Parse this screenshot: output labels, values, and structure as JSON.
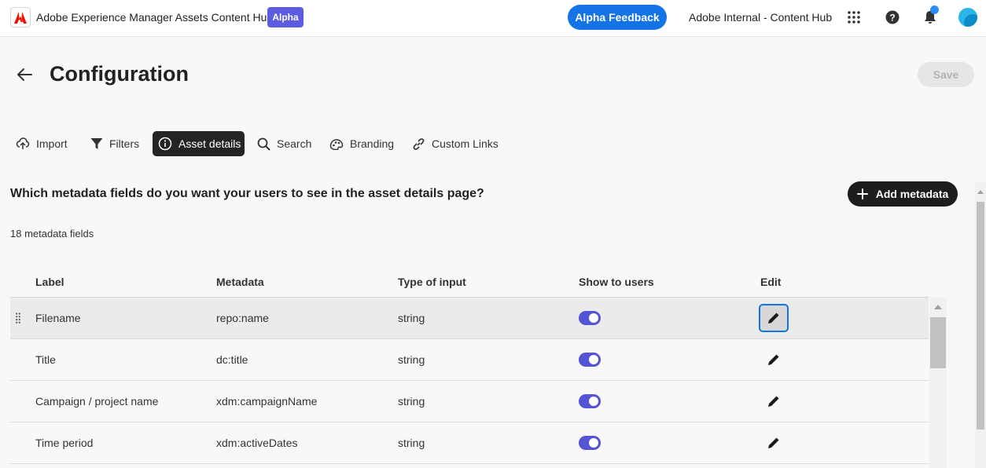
{
  "app": {
    "title": "Adobe Experience Manager Assets Content Hub",
    "badge": "Alpha",
    "feedback_label": "Alpha Feedback",
    "org_name": "Adobe Internal - Content Hub",
    "icons": [
      "adobe-logo-icon",
      "app-switcher-icon",
      "help-icon",
      "bell-icon",
      "avatar"
    ]
  },
  "header": {
    "title": "Configuration",
    "save_label": "Save"
  },
  "tabs": [
    {
      "label": "Import",
      "icon": "upload-icon",
      "active": false
    },
    {
      "label": "Filters",
      "icon": "filter-icon",
      "active": false
    },
    {
      "label": "Asset details",
      "icon": "info-icon",
      "active": true
    },
    {
      "label": "Search",
      "icon": "search-icon",
      "active": false
    },
    {
      "label": "Branding",
      "icon": "branding-icon",
      "active": false
    },
    {
      "label": "Custom Links",
      "icon": "link-icon",
      "active": false
    }
  ],
  "section": {
    "question": "Which metadata fields do you want your users to see in the asset details page?",
    "add_label": "Add metadata",
    "count_text": "18 metadata fields"
  },
  "table": {
    "columns": [
      "Label",
      "Metadata",
      "Type of input",
      "Show to users",
      "Edit"
    ],
    "rows": [
      {
        "label": "Filename",
        "metadata": "repo:name",
        "type": "string",
        "show": true
      },
      {
        "label": "Title",
        "metadata": "dc:title",
        "type": "string",
        "show": true
      },
      {
        "label": "Campaign / project name",
        "metadata": "xdm:campaignName",
        "type": "string",
        "show": true
      },
      {
        "label": "Time period",
        "metadata": "xdm:activeDates",
        "type": "string",
        "show": true
      }
    ]
  },
  "colors": {
    "accent_blue": "#1473e6",
    "alpha_badge": "#5c5ce0",
    "toggle_on": "#5454d4",
    "active_tab": "#242424"
  }
}
